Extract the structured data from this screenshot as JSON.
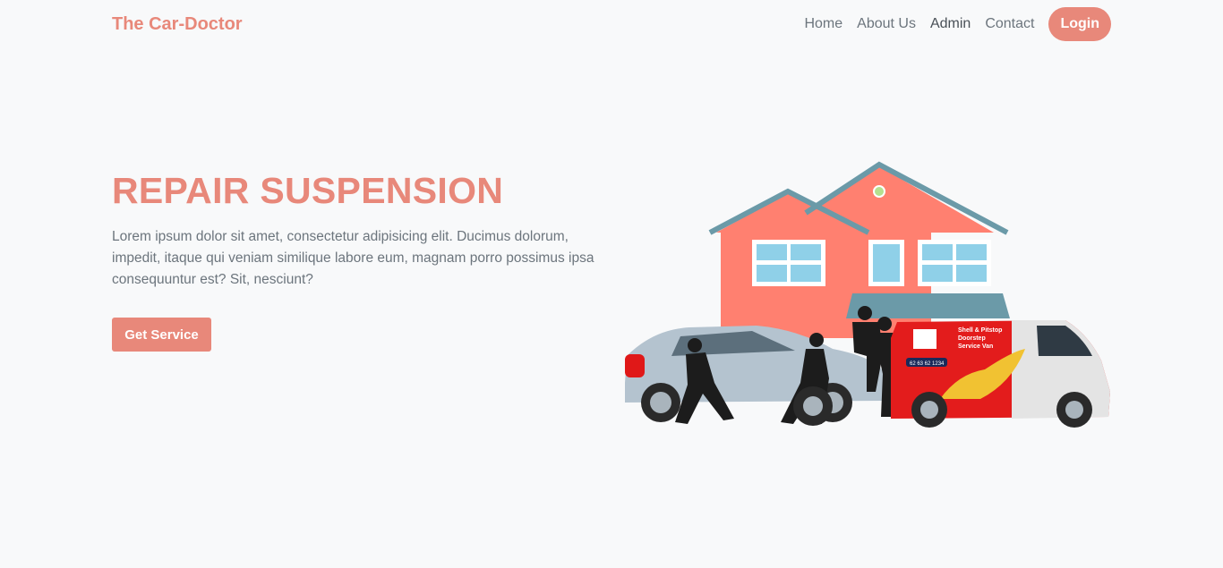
{
  "nav": {
    "brand": "The Car-Doctor",
    "links": [
      {
        "label": "Home"
      },
      {
        "label": "About Us"
      },
      {
        "label": "Admin"
      },
      {
        "label": "Contact"
      }
    ],
    "login_label": "Login"
  },
  "hero": {
    "title": "REPAIR SUSPENSION",
    "description": "Lorem ipsum dolor sit amet, consectetur adipisicing elit. Ducimus dolorum, impedit, itaque qui veniam similique labore eum, magnam porro possimus ipsa consequuntur est? Sit, nesciunt?",
    "cta_label": "Get Service"
  },
  "illustration": {
    "van_line1": "Shell & Pitstop",
    "van_line2": "Doorstep",
    "van_line3": "Service Van",
    "van_phone": "62 63 62 1234"
  },
  "colors": {
    "accent": "#e8887a",
    "background": "#f8f9fa",
    "text_muted": "#6c757d"
  }
}
